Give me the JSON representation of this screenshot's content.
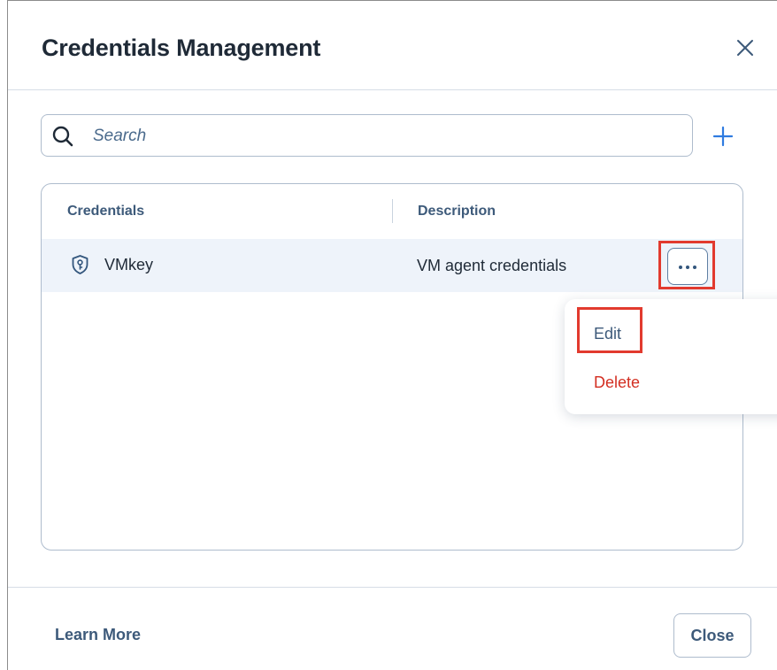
{
  "dialog": {
    "title": "Credentials Management"
  },
  "search": {
    "placeholder": "Search",
    "value": ""
  },
  "table": {
    "columns": [
      "Credentials",
      "Description"
    ],
    "rows": [
      {
        "name": "VMkey",
        "description": "VM agent credentials",
        "icon": "shield-key-icon"
      }
    ]
  },
  "row_menu": {
    "items": [
      "Edit",
      "Delete"
    ]
  },
  "footer": {
    "learn_more": "Learn More",
    "close_label": "Close"
  },
  "icons": {
    "search": "search-icon",
    "add": "plus-icon",
    "close": "close-icon",
    "more": "more-horizontal-icon"
  },
  "colors": {
    "title": "#1f2a37",
    "accent": "#3d5a7a",
    "add_blue": "#2f7be0",
    "danger": "#d32f22",
    "highlight": "#e23a2e",
    "selected_row": "#eef3fa"
  }
}
